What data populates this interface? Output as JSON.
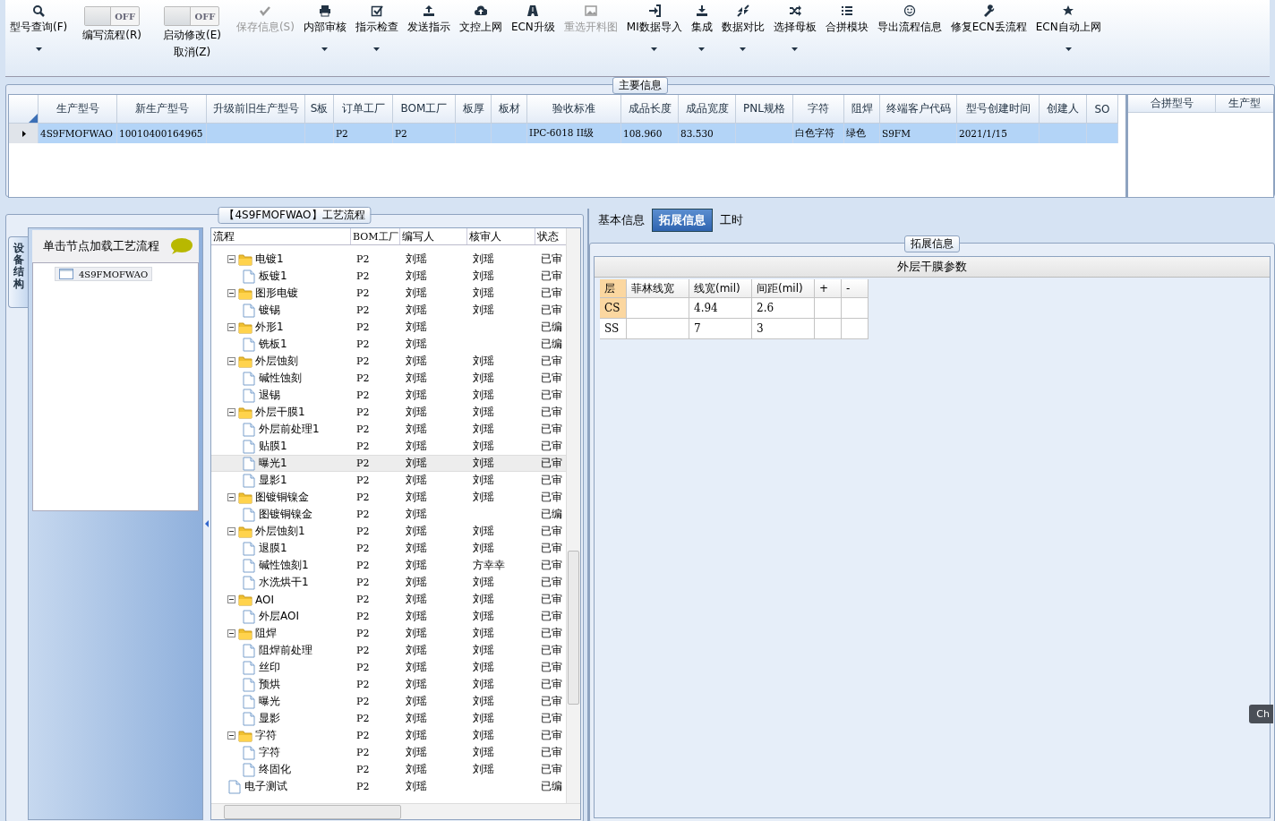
{
  "toolbar": [
    {
      "kind": "button",
      "label": "型号查询(F)",
      "disabled": false,
      "dropdown": true
    },
    {
      "kind": "toggle",
      "label": "编写流程(R)",
      "switch": "OFF",
      "on": false
    },
    {
      "kind": "toggle",
      "label": "启动修改(E)",
      "label2": "取消(Z)",
      "switch": "OFF",
      "on": false
    },
    {
      "kind": "button",
      "label": "保存信息(S)",
      "disabled": true,
      "dropdown": false
    },
    {
      "kind": "button",
      "label": "内部审核",
      "disabled": false,
      "dropdown": true
    },
    {
      "kind": "button",
      "label": "指示检查",
      "disabled": false,
      "dropdown": true
    },
    {
      "kind": "button",
      "label": "发送指示",
      "disabled": false,
      "dropdown": false
    },
    {
      "kind": "button",
      "label": "文控上网",
      "disabled": false,
      "dropdown": false
    },
    {
      "kind": "button",
      "label": "ECN升级",
      "disabled": false,
      "dropdown": false
    },
    {
      "kind": "button",
      "label": "重选开料图",
      "disabled": true,
      "dropdown": false
    },
    {
      "kind": "button",
      "label": "MI数据导入",
      "disabled": false,
      "dropdown": true
    },
    {
      "kind": "button",
      "label": "集成",
      "disabled": false,
      "dropdown": true
    },
    {
      "kind": "button",
      "label": "数据对比",
      "disabled": false,
      "dropdown": true
    },
    {
      "kind": "button",
      "label": "选择母板",
      "disabled": false,
      "dropdown": true
    },
    {
      "kind": "button",
      "label": "合拼模块",
      "disabled": false,
      "dropdown": false
    },
    {
      "kind": "button",
      "label": "导出流程信息",
      "disabled": false,
      "dropdown": false
    },
    {
      "kind": "button",
      "label": "修复ECN丢流程",
      "disabled": false,
      "dropdown": false
    },
    {
      "kind": "button",
      "label": "ECN自动上网",
      "disabled": false,
      "dropdown": true
    }
  ],
  "main_info": {
    "title": "主要信息",
    "columns": [
      "生产型号",
      "新生产型号",
      "升级前旧生产型号",
      "S板",
      "订单工厂",
      "BOM工厂",
      "板厚",
      "板材",
      "验收标准",
      "成品长度",
      "成品宽度",
      "PNL规格",
      "字符",
      "阻焊",
      "终端客户代码",
      "型号创建时间",
      "创建人",
      "SO"
    ],
    "rows": [
      {
        "selected": true,
        "cells": [
          "4S9FMOFWAO",
          "10010400164965",
          "",
          "",
          "P2",
          "P2",
          "",
          "",
          "IPC-6018 II级",
          "108.960",
          "83.530",
          "",
          "白色字符",
          "绿色",
          "S9FM",
          "2021/1/15",
          "",
          ""
        ]
      }
    ],
    "side_columns": [
      "合拼型号",
      "生产型"
    ]
  },
  "left_panel": {
    "title": "【4S9FMOFWAO】工艺流程",
    "vertical_tab": "设备结构",
    "hint": "单击节点加载工艺流程",
    "nodes": [
      {
        "label": "4S9FMOFWAO",
        "selected": true
      }
    ],
    "columns": [
      "流程",
      "BOM工厂",
      "编写人",
      "核审人",
      "状态"
    ],
    "steps": [
      {
        "name": "电镀1",
        "bom": "P2",
        "writer": "刘瑶",
        "reviewer": "刘瑶",
        "status": "已审",
        "selected": false,
        "children": [
          {
            "name": "板镀1",
            "bom": "P2",
            "writer": "刘瑶",
            "reviewer": "刘瑶",
            "status": "已审",
            "selected": false
          }
        ]
      },
      {
        "name": "图形电镀",
        "bom": "P2",
        "writer": "刘瑶",
        "reviewer": "刘瑶",
        "status": "已审",
        "selected": false,
        "children": [
          {
            "name": "镀锡",
            "bom": "P2",
            "writer": "刘瑶",
            "reviewer": "刘瑶",
            "status": "已审",
            "selected": false
          }
        ]
      },
      {
        "name": "外形1",
        "bom": "P2",
        "writer": "刘瑶",
        "status": "已编",
        "selected": false,
        "children": [
          {
            "name": "铣板1",
            "bom": "P2",
            "writer": "刘瑶",
            "status": "已编",
            "selected": false
          }
        ]
      },
      {
        "name": "外层蚀刻",
        "bom": "P2",
        "writer": "刘瑶",
        "reviewer": "刘瑶",
        "status": "已审",
        "selected": false,
        "children": [
          {
            "name": "碱性蚀刻",
            "bom": "P2",
            "writer": "刘瑶",
            "reviewer": "刘瑶",
            "status": "已审",
            "selected": false
          },
          {
            "name": "退锡",
            "bom": "P2",
            "writer": "刘瑶",
            "reviewer": "刘瑶",
            "status": "已审",
            "selected": false
          }
        ]
      },
      {
        "name": "外层干膜1",
        "bom": "P2",
        "writer": "刘瑶",
        "reviewer": "刘瑶",
        "status": "已审",
        "selected": false,
        "children": [
          {
            "name": "外层前处理1",
            "bom": "P2",
            "writer": "刘瑶",
            "reviewer": "刘瑶",
            "status": "已审",
            "selected": false
          },
          {
            "name": "贴膜1",
            "bom": "P2",
            "writer": "刘瑶",
            "reviewer": "刘瑶",
            "status": "已审",
            "selected": false
          },
          {
            "name": "曝光1",
            "bom": "P2",
            "writer": "刘瑶",
            "reviewer": "刘瑶",
            "status": "已审",
            "selected": true
          },
          {
            "name": "显影1",
            "bom": "P2",
            "writer": "刘瑶",
            "reviewer": "刘瑶",
            "status": "已审",
            "selected": false
          }
        ]
      },
      {
        "name": "图镀铜镍金",
        "bom": "P2",
        "writer": "刘瑶",
        "reviewer": "刘瑶",
        "status": "已审",
        "selected": false,
        "children": [
          {
            "name": "图镀铜镍金",
            "bom": "P2",
            "writer": "刘瑶",
            "status": "已编",
            "selected": false
          }
        ]
      },
      {
        "name": "外层蚀刻1",
        "bom": "P2",
        "writer": "刘瑶",
        "reviewer": "刘瑶",
        "status": "已审",
        "selected": false,
        "children": [
          {
            "name": "退膜1",
            "bom": "P2",
            "writer": "刘瑶",
            "reviewer": "刘瑶",
            "status": "已审",
            "selected": false
          },
          {
            "name": "碱性蚀刻1",
            "bom": "P2",
            "writer": "刘瑶",
            "reviewer": "方幸幸",
            "status": "已审",
            "selected": false
          },
          {
            "name": "水洗烘干1",
            "bom": "P2",
            "writer": "刘瑶",
            "reviewer": "刘瑶",
            "status": "已审",
            "selected": false
          }
        ]
      },
      {
        "name": "AOI",
        "bom": "P2",
        "writer": "刘瑶",
        "reviewer": "刘瑶",
        "status": "已审",
        "selected": false,
        "children": [
          {
            "name": "外层AOI",
            "bom": "P2",
            "writer": "刘瑶",
            "reviewer": "刘瑶",
            "status": "已审",
            "selected": false
          }
        ]
      },
      {
        "name": "阻焊",
        "bom": "P2",
        "writer": "刘瑶",
        "reviewer": "刘瑶",
        "status": "已审",
        "selected": false,
        "children": [
          {
            "name": "阻焊前处理",
            "bom": "P2",
            "writer": "刘瑶",
            "reviewer": "刘瑶",
            "status": "已审",
            "selected": false
          },
          {
            "name": "丝印",
            "bom": "P2",
            "writer": "刘瑶",
            "reviewer": "刘瑶",
            "status": "已审",
            "selected": false
          },
          {
            "name": "预烘",
            "bom": "P2",
            "writer": "刘瑶",
            "reviewer": "刘瑶",
            "status": "已审",
            "selected": false
          },
          {
            "name": "曝光",
            "bom": "P2",
            "writer": "刘瑶",
            "reviewer": "刘瑶",
            "status": "已审",
            "selected": false
          },
          {
            "name": "显影",
            "bom": "P2",
            "writer": "刘瑶",
            "reviewer": "刘瑶",
            "status": "已审",
            "selected": false
          }
        ]
      },
      {
        "name": "字符",
        "bom": "P2",
        "writer": "刘瑶",
        "reviewer": "刘瑶",
        "status": "已审",
        "selected": false,
        "children": [
          {
            "name": "字符",
            "bom": "P2",
            "writer": "刘瑶",
            "reviewer": "刘瑶",
            "status": "已审",
            "selected": false
          },
          {
            "name": "终固化",
            "bom": "P2",
            "writer": "刘瑶",
            "reviewer": "刘瑶",
            "status": "已审",
            "selected": false
          }
        ]
      },
      {
        "name": "电子测试",
        "bom": "P2",
        "writer": "刘瑶",
        "status": "已编",
        "selected": false
      }
    ]
  },
  "right_panel": {
    "tabs": [
      {
        "label": "基本信息",
        "selected": false
      },
      {
        "label": "拓展信息",
        "selected": true
      },
      {
        "label": "工时",
        "selected": false
      }
    ],
    "group_title": "拓展信息",
    "grid_title": "外层干膜参数",
    "columns": [
      "层",
      "菲林线宽",
      "线宽(mil)",
      "间距(mil)",
      "+",
      "-"
    ],
    "rows": [
      {
        "selected": true,
        "cells": [
          "CS",
          "",
          "4.94",
          "2.6",
          "",
          ""
        ]
      },
      {
        "selected": false,
        "cells": [
          "SS",
          "",
          "7",
          "3",
          "",
          ""
        ]
      }
    ],
    "side_tab": "Ch"
  }
}
